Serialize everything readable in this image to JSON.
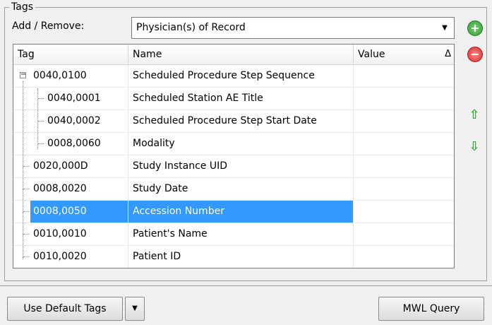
{
  "group": {
    "title": "Tags"
  },
  "add_remove": {
    "label": "Add / Remove:",
    "selected": "Physician(s) of Record"
  },
  "columns": {
    "tag": "Tag",
    "name": "Name",
    "value": "Value"
  },
  "rows": [
    {
      "tag": "0040,0100",
      "name": "Scheduled Procedure Step Sequence",
      "value": ""
    },
    {
      "tag": "0040,0001",
      "name": "Scheduled Station AE Title",
      "value": ""
    },
    {
      "tag": "0040,0002",
      "name": "Scheduled Procedure Step Start Date",
      "value": ""
    },
    {
      "tag": "0008,0060",
      "name": "Modality",
      "value": ""
    },
    {
      "tag": "0020,000D",
      "name": "Study Instance UID",
      "value": ""
    },
    {
      "tag": "0008,0020",
      "name": "Study Date",
      "value": ""
    },
    {
      "tag": "0008,0050",
      "name": "Accession Number",
      "value": ""
    },
    {
      "tag": "0010,0010",
      "name": "Patient's Name",
      "value": ""
    },
    {
      "tag": "0010,0020",
      "name": "Patient ID",
      "value": ""
    }
  ],
  "buttons": {
    "default_tags": "Use Default Tags",
    "mwl_query": "MWL Query"
  },
  "colors": {
    "selection": "#3399ff",
    "add": "#2e9b2e",
    "remove": "#d42a2a",
    "move": "#3cae3c"
  },
  "icons": [
    "add-icon",
    "remove-icon",
    "move-up-icon",
    "move-down-icon",
    "sort-triangle-icon",
    "dropdown-arrow-icon"
  ]
}
